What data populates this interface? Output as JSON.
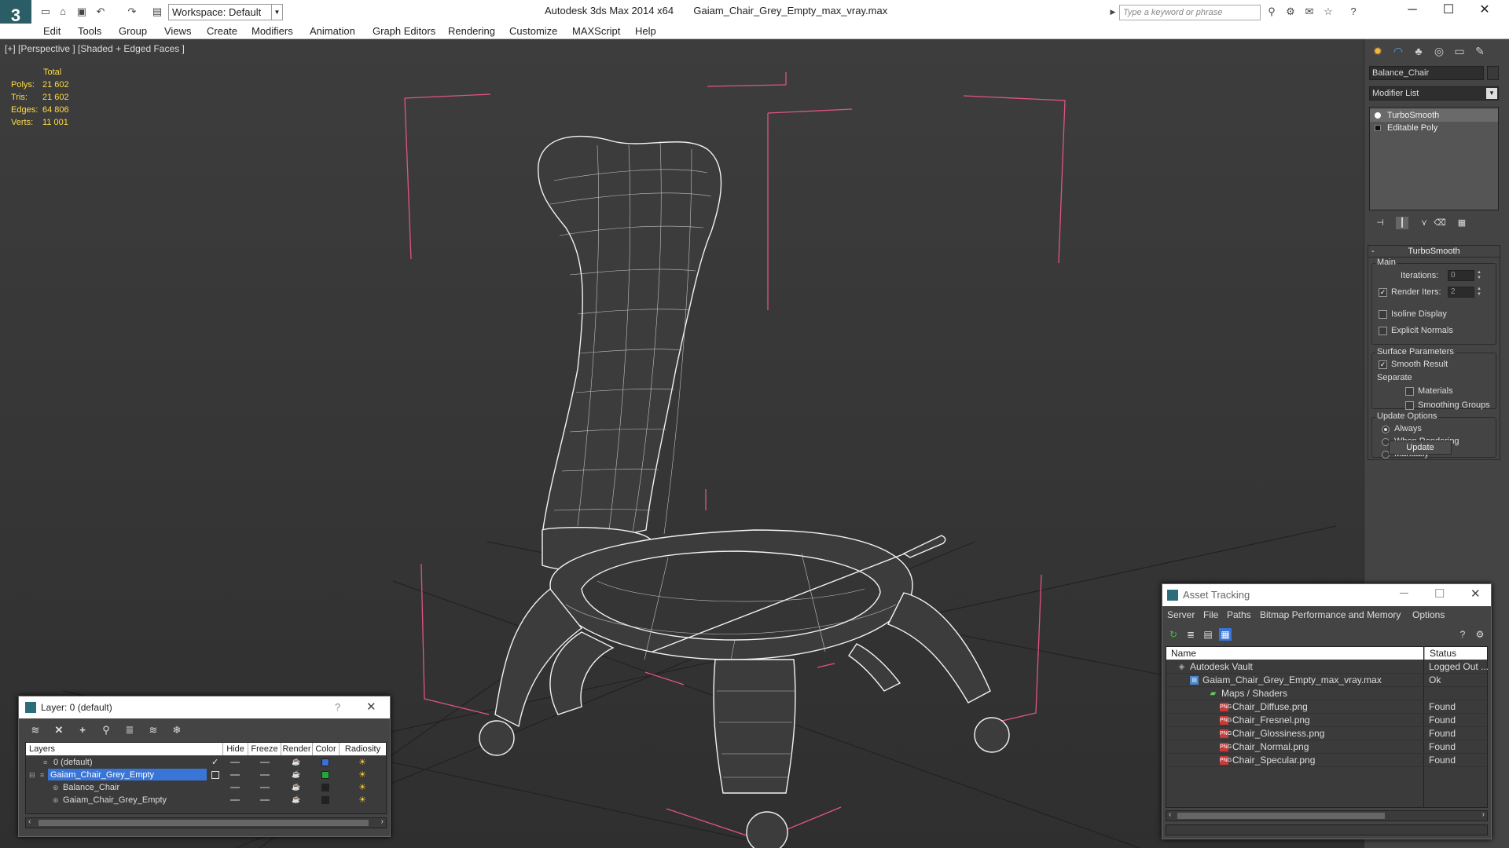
{
  "titlebar": {
    "app_title": "Autodesk 3ds Max  2014 x64",
    "file_name": "Gaiam_Chair_Grey_Empty_max_vray.max",
    "workspace": "Workspace: Default",
    "search_placeholder": "Type a keyword or phrase"
  },
  "menu": [
    "Edit",
    "Tools",
    "Group",
    "Views",
    "Create",
    "Modifiers",
    "Animation",
    "Graph Editors",
    "Rendering",
    "Customize",
    "MAXScript",
    "Help"
  ],
  "viewport": {
    "label": "[+] [Perspective ] [Shaded + Edged Faces ]",
    "stats": {
      "total_label": "Total",
      "rows": [
        {
          "name": "Polys:",
          "value": "21 602"
        },
        {
          "name": "Tris:",
          "value": "21 602"
        },
        {
          "name": "Edges:",
          "value": "64 806"
        },
        {
          "name": "Verts:",
          "value": "11 001"
        }
      ]
    }
  },
  "command_panel": {
    "object_name": "Balance_Chair",
    "modifier_list": "Modifier List",
    "stack": [
      "TurboSmooth",
      "Editable Poly"
    ],
    "turbosmooth": {
      "title": "TurboSmooth",
      "main_label": "Main",
      "iterations_label": "Iterations:",
      "iterations_value": "0",
      "render_iters_label": "Render Iters:",
      "render_iters_value": "2",
      "isoline_label": "Isoline Display",
      "explicit_normals_label": "Explicit Normals",
      "surface_label": "Surface Parameters",
      "smooth_result_label": "Smooth Result",
      "separate_label": "Separate",
      "materials_label": "Materials",
      "smoothing_groups_label": "Smoothing Groups",
      "update_options_label": "Update Options",
      "always_label": "Always",
      "when_rendering_label": "When Rendering",
      "manually_label": "Manually",
      "update_button": "Update"
    }
  },
  "layer_dialog": {
    "title": "Layer: 0 (default)",
    "help": "?",
    "columns": [
      "Layers",
      "Hide",
      "Freeze",
      "Render",
      "Color",
      "Radiosity"
    ],
    "rows": [
      {
        "name": "0 (default)",
        "color": "#3a6fd8",
        "selected": false
      },
      {
        "name": "Gaiam_Chair_Grey_Empty",
        "color": "#22a83a",
        "selected": true
      },
      {
        "name": "Balance_Chair",
        "color": "#222222",
        "selected": false
      },
      {
        "name": "Gaiam_Chair_Grey_Empty",
        "color": "#222222",
        "selected": false
      }
    ]
  },
  "asset_tracking": {
    "title": "Asset Tracking",
    "menu": [
      "Server",
      "File",
      "Paths",
      "Bitmap Performance and Memory",
      "Options"
    ],
    "columns": [
      "Name",
      "Status"
    ],
    "rows": [
      {
        "name": "Autodesk Vault",
        "status": "Logged Out ...",
        "icon": "vault-icon"
      },
      {
        "name": "Gaiam_Chair_Grey_Empty_max_vray.max",
        "status": "Ok",
        "icon": "max-file-icon"
      },
      {
        "name": "Maps / Shaders",
        "status": "",
        "icon": "maps-icon"
      },
      {
        "name": "Chair_Diffuse.png",
        "status": "Found",
        "icon": "png-icon"
      },
      {
        "name": "Chair_Fresnel.png",
        "status": "Found",
        "icon": "png-icon"
      },
      {
        "name": "Chair_Glossiness.png",
        "status": "Found",
        "icon": "png-icon"
      },
      {
        "name": "Chair_Normal.png",
        "status": "Found",
        "icon": "png-icon"
      },
      {
        "name": "Chair_Specular.png",
        "status": "Found",
        "icon": "png-icon"
      }
    ]
  },
  "colors": {
    "stats_yellow": "#ffdc46",
    "bbox_pink": "#e05580",
    "selection_blue": "#3875d7"
  }
}
